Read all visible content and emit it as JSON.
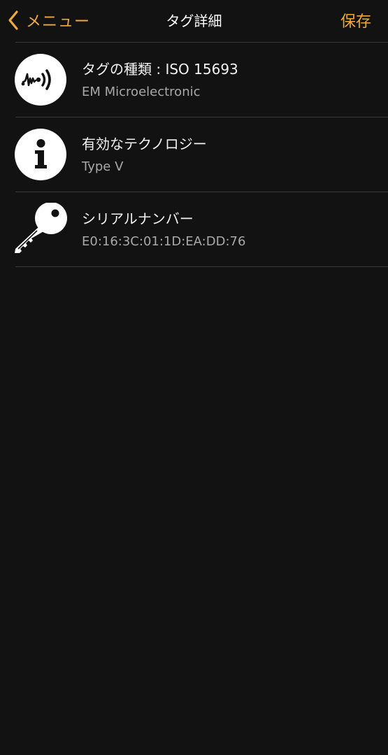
{
  "navbar": {
    "back_label": "メニュー",
    "title": "タグ詳細",
    "save_label": "保存"
  },
  "rows": [
    {
      "icon": "nfc-signal-icon",
      "title": "タグの種類 : ISO 15693",
      "subtitle": "EM Microelectronic"
    },
    {
      "icon": "info-icon",
      "title": "有効なテクノロジー",
      "subtitle": "Type V"
    },
    {
      "icon": "key-icon",
      "title": "シリアルナンバー",
      "subtitle": "E0:16:3C:01:1D:EA:DD:76"
    }
  ],
  "colors": {
    "accent": "#f0a93a",
    "background": "#121212",
    "divider": "#3a3a3a",
    "title_text": "#f2f2f2",
    "subtitle_text": "#a9a9a9"
  }
}
